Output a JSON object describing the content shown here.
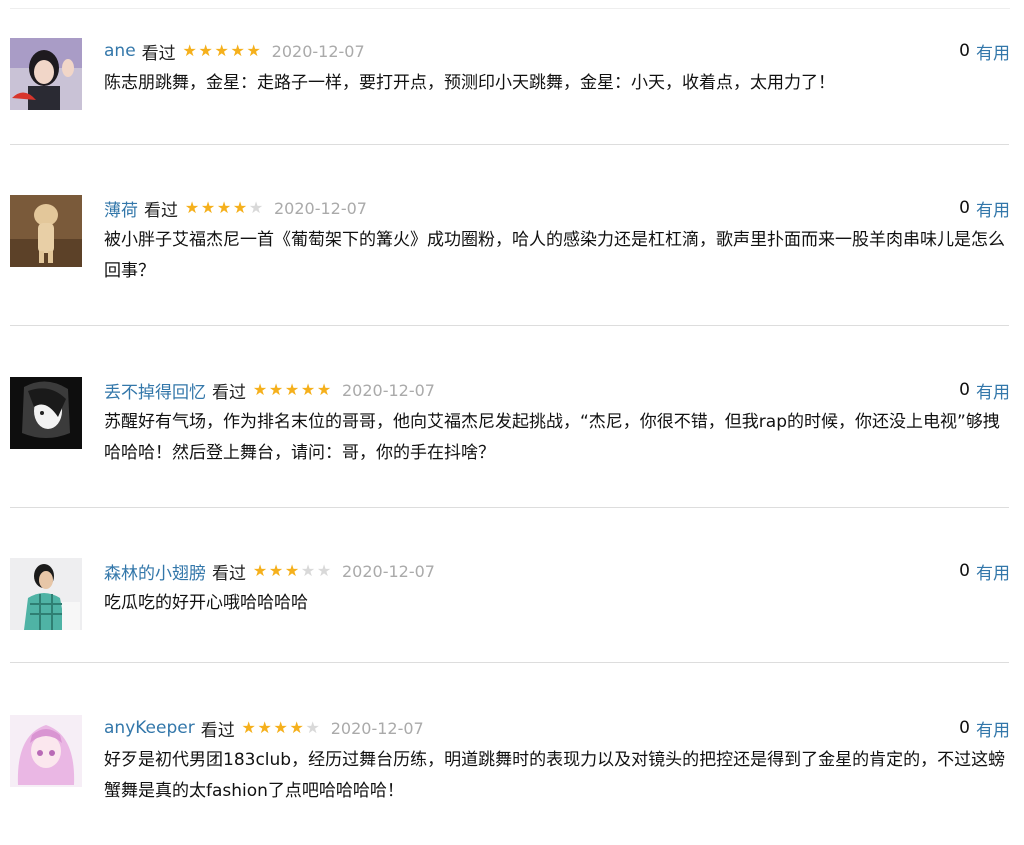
{
  "comments": [
    {
      "user": "ane",
      "status": "看过",
      "rating": 5,
      "date": "2020-12-07",
      "votes": "0",
      "useful_label": "有用",
      "text": "陈志朋跳舞，金星：走路子一样，要打开点，预测印小天跳舞，金星：小天，收着点，太用力了！"
    },
    {
      "user": "薄荷",
      "status": "看过",
      "rating": 4,
      "date": "2020-12-07",
      "votes": "0",
      "useful_label": "有用",
      "text": "被小胖子艾福杰尼一首《葡萄架下的篝火》成功圈粉，哈人的感染力还是杠杠滴，歌声里扑面而来一股羊肉串味儿是怎么回事？"
    },
    {
      "user": "丢不掉得回忆",
      "status": "看过",
      "rating": 5,
      "date": "2020-12-07",
      "votes": "0",
      "useful_label": "有用",
      "text": "苏醒好有气场，作为排名末位的哥哥，他向艾福杰尼发起挑战，“杰尼，你很不错，但我rap的时候，你还没上电视”够拽哈哈哈！然后登上舞台，请问：哥，你的手在抖啥？"
    },
    {
      "user": "森林的小翅膀",
      "status": "看过",
      "rating": 3,
      "date": "2020-12-07",
      "votes": "0",
      "useful_label": "有用",
      "text": "吃瓜吃的好开心哦哈哈哈哈"
    },
    {
      "user": "anyKeeper",
      "status": "看过",
      "rating": 4,
      "date": "2020-12-07",
      "votes": "0",
      "useful_label": "有用",
      "text": "好歹是初代男团183club，经历过舞台历练，明道跳舞时的表现力以及对镜头的把控还是得到了金星的肯定的，不过这螃蟹舞是真的太fashion了点吧哈哈哈哈！"
    }
  ]
}
